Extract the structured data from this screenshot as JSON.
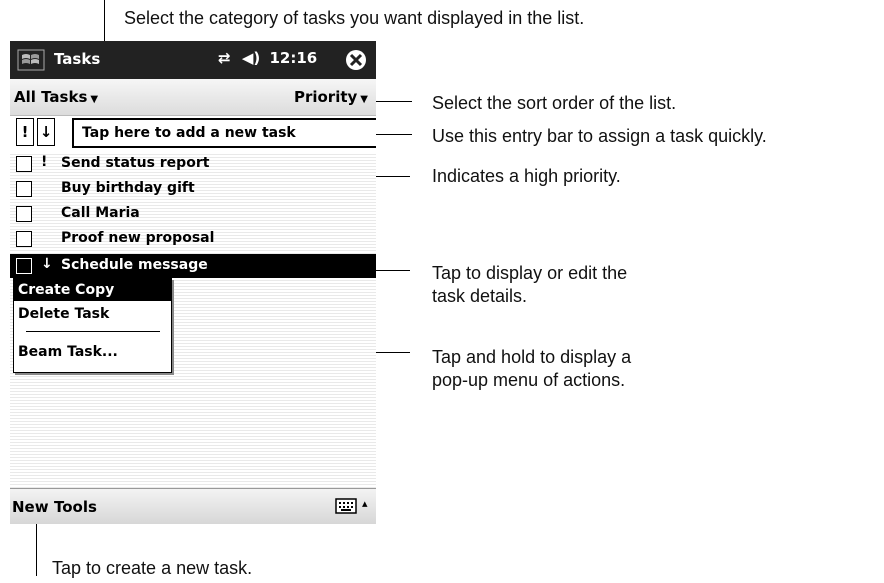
{
  "callouts": {
    "category": "Select the category of tasks you want displayed in the list.",
    "sort": "Select the sort order of the list.",
    "entry": "Use this entry bar to assign a task quickly.",
    "priority": "Indicates a high priority.",
    "details_1": "Tap to display or edit the",
    "details_2": "task details.",
    "popup_1": "Tap and hold to display a",
    "popup_2": "pop-up menu of actions.",
    "new": "Tap to create a new task."
  },
  "device": {
    "titlebar": {
      "app_title": "Tasks",
      "time": "12:16",
      "start_icon": "windows-flag-icon",
      "close_icon": "close-circle-icon"
    },
    "filterbar": {
      "category": "All Tasks",
      "sort": "Priority"
    },
    "entrybar": {
      "priority_btn": "!",
      "sort_btn": "↓",
      "placeholder": "Tap here to add a new task"
    },
    "tasks": [
      {
        "priority": "!",
        "label": "Send status report"
      },
      {
        "priority": "",
        "label": "Buy birthday gift"
      },
      {
        "priority": "",
        "label": "Call Maria"
      },
      {
        "priority": "",
        "label": "Proof new proposal"
      },
      {
        "priority": "↓",
        "label": "Schedule message"
      }
    ],
    "popup_menu": [
      "Create Copy",
      "Delete Task",
      "Beam Task..."
    ],
    "bottombar": {
      "new": "New",
      "tools": "Tools",
      "sip_arrow": "▴"
    }
  }
}
